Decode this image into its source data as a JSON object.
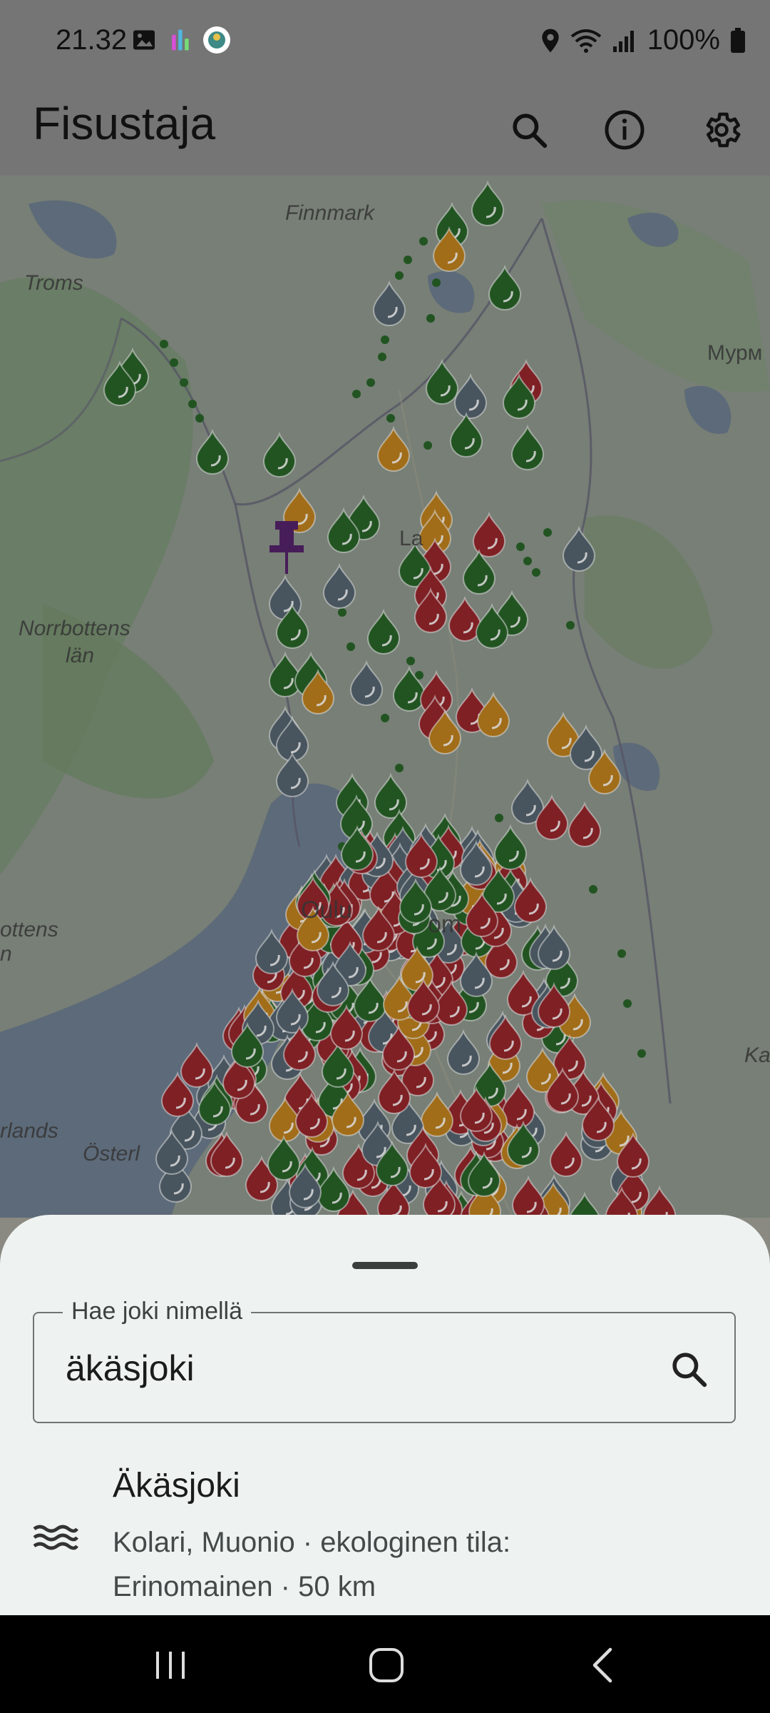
{
  "status_bar": {
    "time": "21.32",
    "battery": "100%"
  },
  "app_bar": {
    "title": "Fisustaja",
    "actions": [
      "search-icon",
      "info-icon",
      "settings-icon"
    ]
  },
  "map": {
    "labels": {
      "finnmark": "Finnmark",
      "troms": "Troms",
      "murm": "Мурм",
      "norrbottens": "Norrbottens",
      "lan": "län",
      "oulu": "Oulu",
      "ka": "Ka",
      "lapland_partial": "La",
      "kom_partial": "om",
      "ottens": "ottens",
      "n_partial": "n",
      "rlands": "rlands",
      "osterl": "Österl"
    },
    "marker_colors": {
      "excellent": "#1d5a1d",
      "good": "#b87812",
      "moderate": "#8e1a1f",
      "unknown": "#4b5b66",
      "pin": "#4a1760"
    }
  },
  "search": {
    "label": "Hae joki nimellä",
    "value": "äkäsjoki"
  },
  "results": [
    {
      "title": "Äkäsjoki",
      "subtitle": "Kolari, Muonio · ekologinen tila: Erinomainen · 50 km"
    }
  ]
}
